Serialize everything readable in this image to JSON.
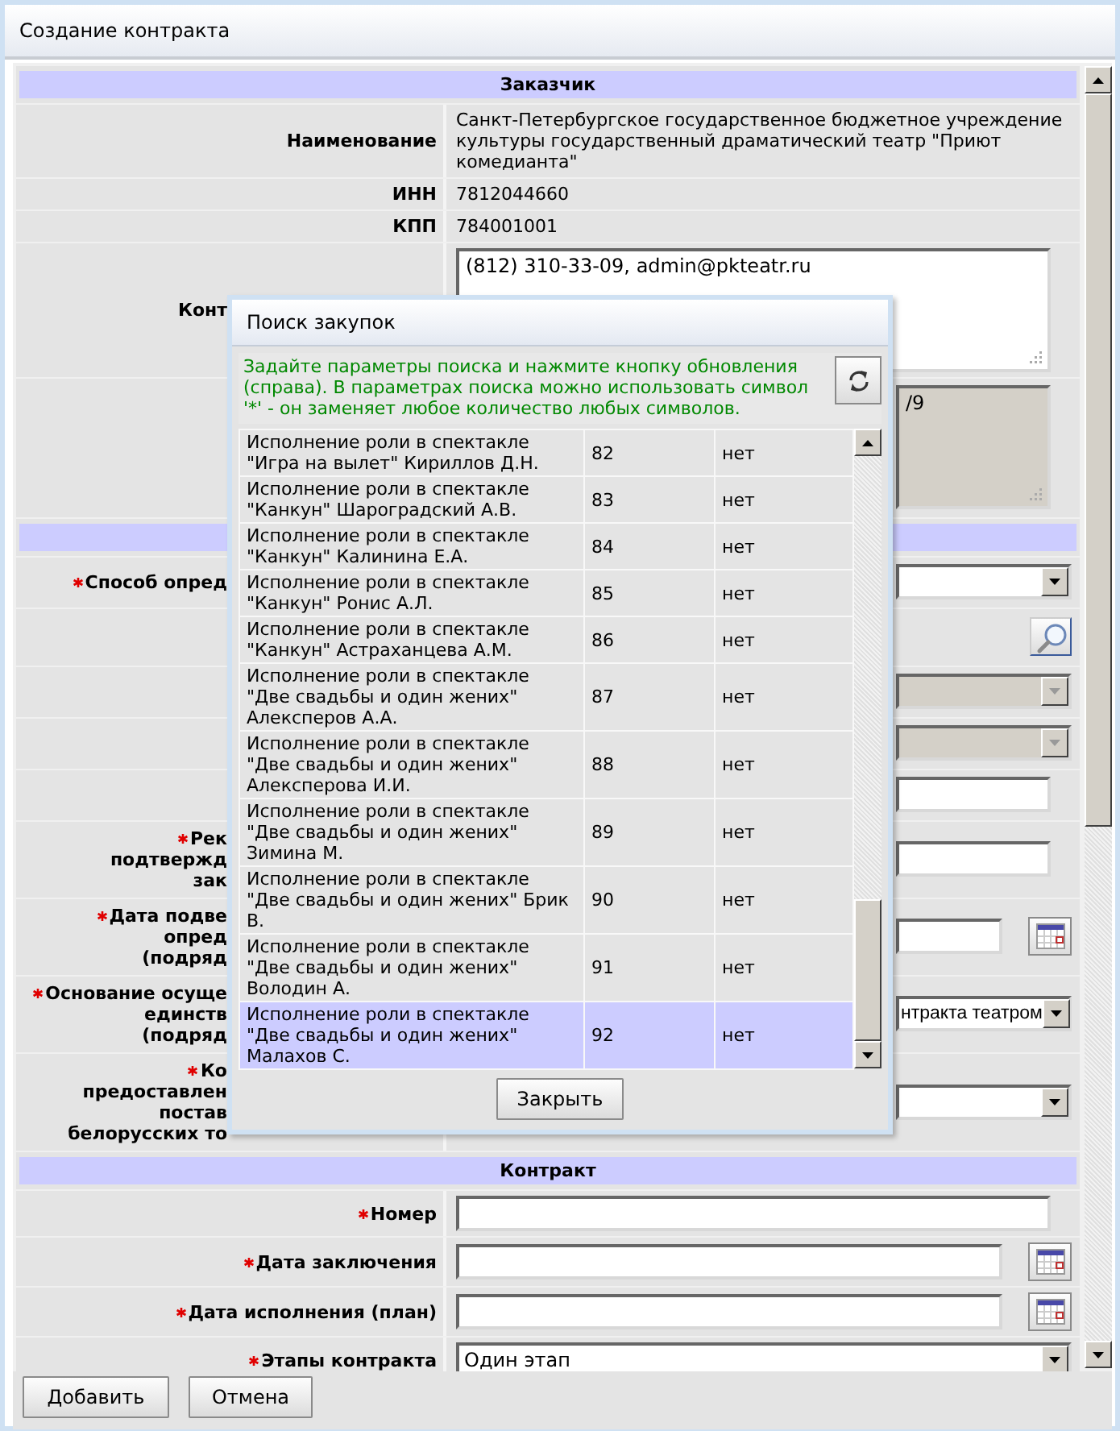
{
  "window": {
    "title": "Создание контракта"
  },
  "form": [
    {
      "kind": "header",
      "title": "Заказчик"
    },
    {
      "kind": "text",
      "label": [
        "Наименование"
      ],
      "value": "Санкт-Петербургское государственное бюджетное учреждение культуры государственный драматический театр \"Приют комедианта\""
    },
    {
      "kind": "text",
      "label": [
        "ИНН"
      ],
      "value": "7812044660"
    },
    {
      "kind": "text",
      "label": [
        "КПП"
      ],
      "value": "784001001"
    },
    {
      "kind": "textarea",
      "label": [
        "Конт"
      ],
      "value": "(812) 310-33-09, admin@pkteatr.ru",
      "disabled": false,
      "label_covered": true,
      "field_covered": false
    },
    {
      "kind": "textarea",
      "value": "/9",
      "disabled": true,
      "field_covered": true
    },
    {
      "kind": "header"
    },
    {
      "kind": "select",
      "label": [
        "Способ опред"
      ],
      "required": true,
      "disabled": false,
      "label_covered": true,
      "field_covered": true
    },
    {
      "kind": "search"
    },
    {
      "kind": "select",
      "disabled": true,
      "field_covered": true
    },
    {
      "kind": "select",
      "disabled": true,
      "field_covered": true
    },
    {
      "kind": "input",
      "disabled": false,
      "field_covered": true
    },
    {
      "kind": "input",
      "label": [
        "Рек",
        "подтвержд",
        "зак"
      ],
      "required": true,
      "disabled": false,
      "label_covered": true,
      "field_covered": true
    },
    {
      "kind": "date",
      "label": [
        "Дата подве",
        "опред",
        "(подряд"
      ],
      "required": true,
      "disabled": false,
      "label_covered": true,
      "field_covered": true
    },
    {
      "kind": "select",
      "label": [
        "Основание осуще",
        "единств",
        "(подряд"
      ],
      "value": "нтракта театром",
      "required": true,
      "disabled": false,
      "label_covered": true,
      "field_covered": true
    },
    {
      "kind": "select",
      "label": [
        "Ко",
        "предоставлен",
        "постав",
        "белорусских то"
      ],
      "required": true,
      "disabled": false,
      "label_covered": true,
      "field_covered": true
    },
    {
      "kind": "header",
      "title": "Контракт"
    },
    {
      "kind": "input",
      "label": [
        "Номер"
      ],
      "required": true,
      "disabled": false
    },
    {
      "kind": "date",
      "label": [
        "Дата заключения"
      ],
      "required": true,
      "disabled": false
    },
    {
      "kind": "date",
      "label": [
        "Дата исполнения (план)"
      ],
      "required": true,
      "disabled": false
    },
    {
      "kind": "select",
      "label": [
        "Этапы контракта"
      ],
      "value": "Один этап",
      "required": true,
      "disabled": false
    }
  ],
  "dialog": {
    "title": "Поиск закупок",
    "hint": "Задайте параметры поиска и нажмите кнопку обновления (справа). В параметрах поиска можно использовать символ '*' - он заменяет любое количество любых символов.",
    "rows": [
      {
        "name": "Исполнение роли в спектакле \"Игра на вылет\" Кириллов Д.Н.",
        "number": "82",
        "flag": "нет",
        "selected": false
      },
      {
        "name": "Исполнение роли в спектакле \"Канкун\" Шароградский А.В.",
        "number": "83",
        "flag": "нет",
        "selected": false
      },
      {
        "name": "Исполнение роли в спектакле \"Канкун\" Калинина Е.А.",
        "number": "84",
        "flag": "нет",
        "selected": false
      },
      {
        "name": "Исполнение роли в спектакле \"Канкун\" Ронис А.Л.",
        "number": "85",
        "flag": "нет",
        "selected": false
      },
      {
        "name": "Исполнение роли в спектакле \"Канкун\" Астраханцева А.М.",
        "number": "86",
        "flag": "нет",
        "selected": false
      },
      {
        "name": "Исполнение роли в спектакле \"Две свадьбы и один жених\" Алексперов А.А.",
        "number": "87",
        "flag": "нет",
        "selected": false
      },
      {
        "name": "Исполнение роли в спектакле \"Две свадьбы и один жених\" Алексперова И.И.",
        "number": "88",
        "flag": "нет",
        "selected": false
      },
      {
        "name": "Исполнение роли в спектакле \"Две свадьбы и один жених\" Зимина М.",
        "number": "89",
        "flag": "нет",
        "selected": false
      },
      {
        "name": "Исполнение роли в спектакле \"Две свадьбы и один жених\" Брик В.",
        "number": "90",
        "flag": "нет",
        "selected": false
      },
      {
        "name": "Исполнение роли в спектакле \"Две свадьбы и один жених\" Володин А.",
        "number": "91",
        "flag": "нет",
        "selected": false
      },
      {
        "name": "Исполнение роли в спектакле \"Две свадьбы и один жених\" Малахов С.",
        "number": "92",
        "flag": "нет",
        "selected": true
      }
    ],
    "close_button": "Закрыть"
  },
  "buttons": [
    "Добавить",
    "Отмена"
  ]
}
